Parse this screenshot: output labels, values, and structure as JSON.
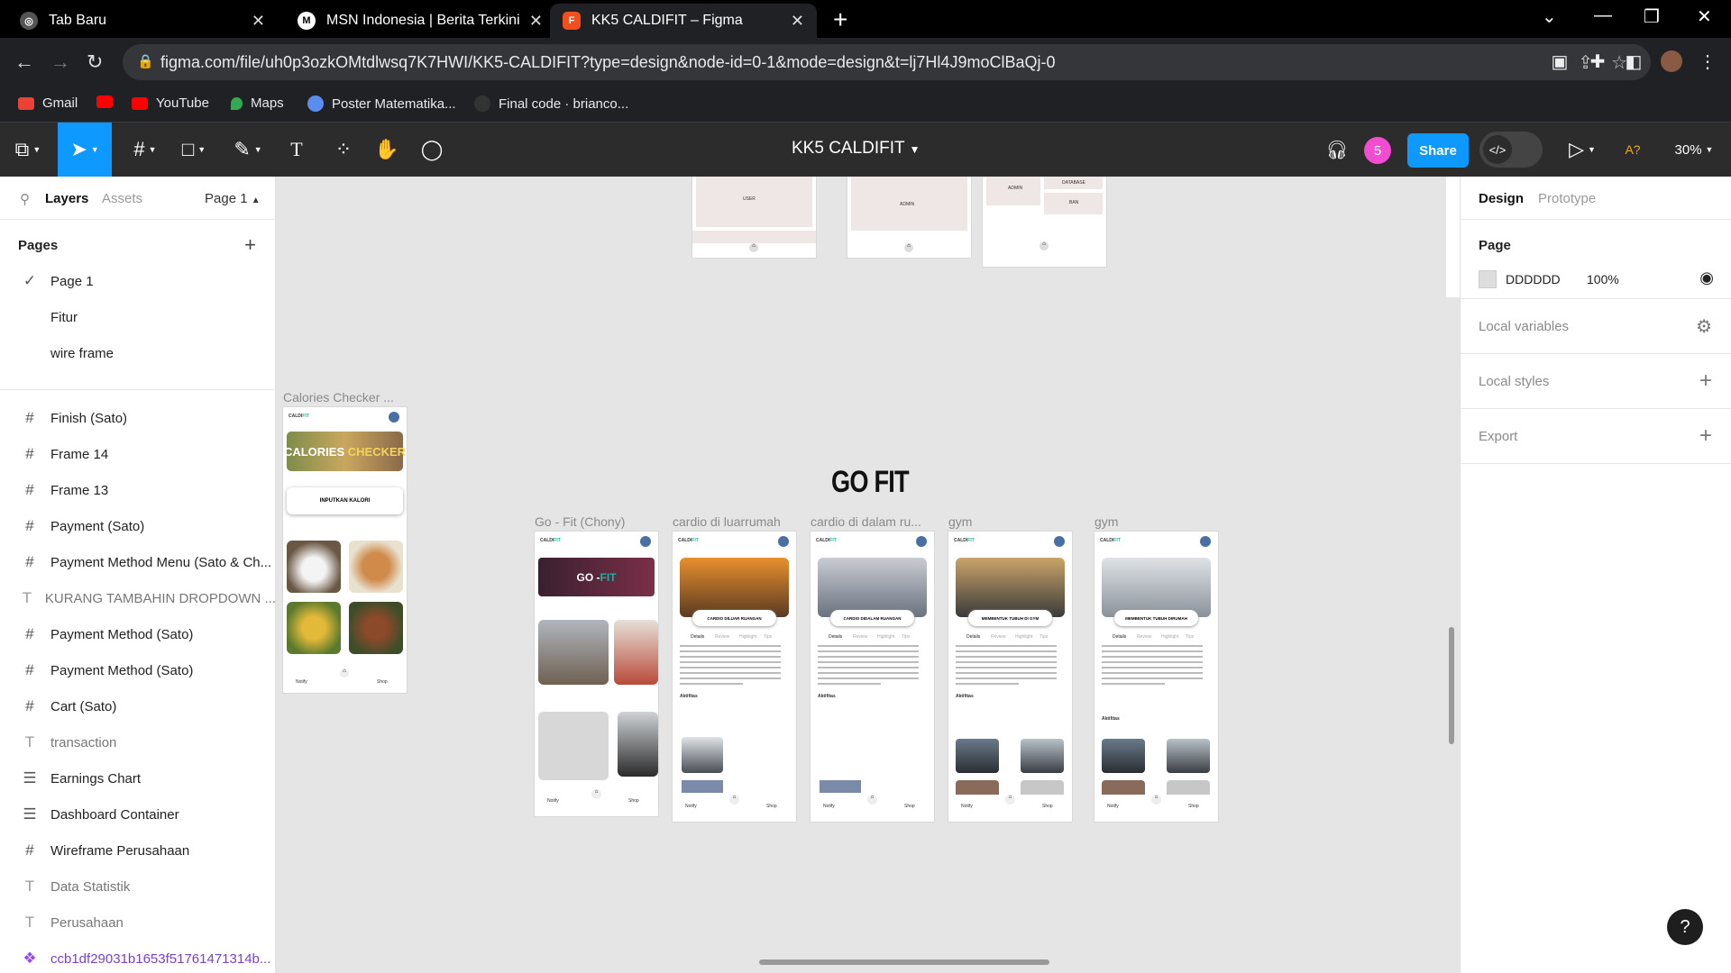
{
  "browser": {
    "tabs": [
      {
        "title": "Tab Baru",
        "icon": "globe-icon"
      },
      {
        "title": "MSN Indonesia | Berita Terkini H",
        "icon": "msn-icon"
      },
      {
        "title": "KK5 CALDIFIT – Figma",
        "icon": "figma-icon"
      }
    ],
    "url": "figma.com/file/uh0p3ozkOMtdlwsq7K7HWI/KK5-CALDIFIT?type=design&node-id=0-1&mode=design&t=lj7Hl4J9moClBaQj-0",
    "bookmarks": [
      "Gmail",
      "",
      "YouTube",
      "Maps",
      "Poster Matematika...",
      "Final code · brianco..."
    ]
  },
  "figma": {
    "file_title": "KK5 CALDIFIT",
    "avatar_count": "5",
    "share_label": "Share",
    "zoom": "30%",
    "font_warning": "A?"
  },
  "left_panel": {
    "tabs": {
      "layers": "Layers",
      "assets": "Assets",
      "page_selector": "Page 1"
    },
    "pages_heading": "Pages",
    "pages": [
      "Page 1",
      "Fitur",
      "wire frame"
    ],
    "layers": [
      {
        "type": "frame",
        "name": "Finish (Sato)"
      },
      {
        "type": "frame",
        "name": "Frame 14"
      },
      {
        "type": "frame",
        "name": "Frame 13"
      },
      {
        "type": "frame",
        "name": "Payment (Sato)"
      },
      {
        "type": "frame",
        "name": "Payment Method Menu (Sato & Ch..."
      },
      {
        "type": "text",
        "name": "KURANG TAMBAHIN DROPDOWN ..."
      },
      {
        "type": "frame",
        "name": "Payment Method (Sato)"
      },
      {
        "type": "frame",
        "name": "Payment Method (Sato)"
      },
      {
        "type": "frame",
        "name": "Cart (Sato)"
      },
      {
        "type": "text",
        "name": "transaction"
      },
      {
        "type": "list",
        "name": "Earnings Chart"
      },
      {
        "type": "list",
        "name": "Dashboard Container"
      },
      {
        "type": "frame",
        "name": "Wireframe Perusahaan"
      },
      {
        "type": "text",
        "name": "Data Statistik"
      },
      {
        "type": "text",
        "name": "Perusahaan"
      },
      {
        "type": "component",
        "name": "ccb1df29031b1653f51761471314b..."
      }
    ]
  },
  "canvas": {
    "top_frames": [
      {
        "label": "USER"
      },
      {
        "label": "ADMIN"
      },
      {
        "label": "ADMIN",
        "label2": "DATABASE",
        "label3": "BAN"
      }
    ],
    "go_fit_title": "GO FIT",
    "calories_frame": {
      "label": "Calories Checker ...",
      "banner_a": "CALORIES",
      "banner_b": "CHECKER",
      "input_btn": "INPUTKAN KALORI"
    },
    "frames": [
      {
        "label": "Go - Fit (Chony)",
        "banner_a": "GO - ",
        "banner_b": "FIT"
      },
      {
        "label": "cardio di luarrumah",
        "pill": "CARDIO DILUAR RUANGAN"
      },
      {
        "label": "cardio di dalam ru...",
        "pill": "CARDIO DIDALAM RUANGAN"
      },
      {
        "label": "gym",
        "pill": "MEMBENTUK TUBUH DI GYM"
      },
      {
        "label": "gym",
        "pill": "MEMBENTUK TUBUH DIRUMAH"
      }
    ],
    "brand": "CALDI",
    "brand_accent": "FIT",
    "subtabs": [
      "Details",
      "Review",
      "Highlight",
      "Tips"
    ],
    "aktifitas": "Aktifitas",
    "nav": {
      "left": "Notify",
      "right": "Shop"
    }
  },
  "right_panel": {
    "tabs": {
      "design": "Design",
      "prototype": "Prototype"
    },
    "page_heading": "Page",
    "page_color": "DDDDDD",
    "page_opacity": "100%",
    "local_variables": "Local variables",
    "local_styles": "Local styles",
    "export": "Export"
  },
  "colors": {
    "accent": "#0d99ff",
    "avatar": "#f24dd1",
    "canvas": "#e5e5e5"
  }
}
